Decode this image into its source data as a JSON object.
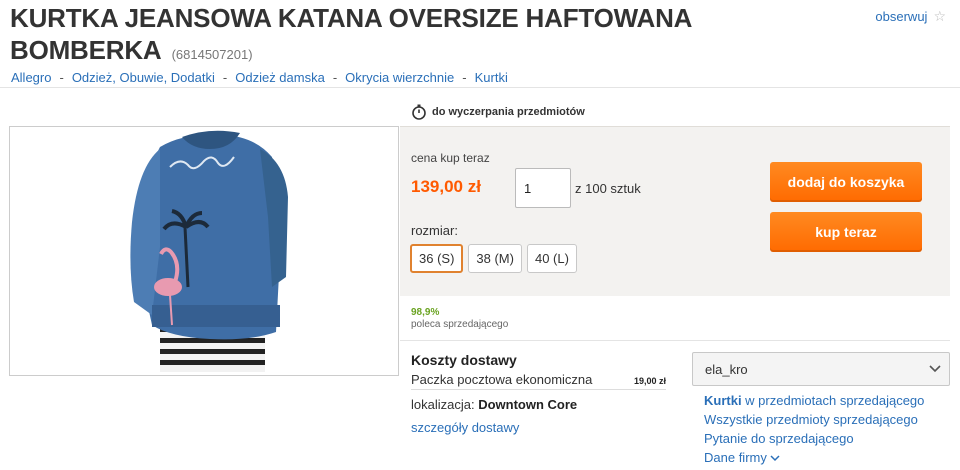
{
  "product": {
    "title": "KURTKA JEANSOWA KATANA OVERSIZE HAFTOWANA BOMBERKA",
    "id": "(6814507201)"
  },
  "watch": {
    "label": "obserwuj",
    "icon": "star-icon"
  },
  "breadcrumb": [
    "Allegro",
    "Odzież, Obuwie, Dodatki",
    "Odzież damska",
    "Okrycia wierzchnie",
    "Kurtki"
  ],
  "timer": {
    "text": "do wyczerpania przedmiotów",
    "icon": "stopwatch-icon"
  },
  "buy": {
    "price_label": "cena kup teraz",
    "price": "139,00 zł",
    "quantity": "1",
    "quantity_of": "z 100 sztuk",
    "size_label": "rozmiar:",
    "sizes": [
      "36 (S)",
      "38 (M)",
      "40 (L)"
    ],
    "selected_size": "36 (S)",
    "cart_button": "dodaj do koszyka",
    "buy_button": "kup teraz",
    "accent_color": "#ff6a00"
  },
  "rating": {
    "percent": "98,9%",
    "text": "poleca sprzedającego"
  },
  "shipping": {
    "title": "Koszty dostawy",
    "method": "Paczka pocztowa ekonomiczna",
    "cost": "19,00 zł",
    "location_label": "lokalizacja:",
    "location": "Downtown Core",
    "details_link": "szczegóły dostawy"
  },
  "seller": {
    "name": "ela_kro",
    "category": "Kurtki",
    "category_suffix": " w przedmiotach sprzedającego",
    "all_items": "Wszystkie przedmioty sprzedającego",
    "ask": "Pytanie do sprzedającego",
    "company": "Dane firmy"
  }
}
